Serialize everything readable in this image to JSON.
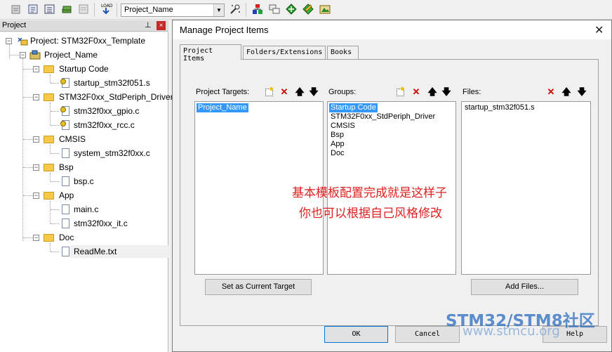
{
  "toolbar": {
    "target_select": {
      "value": "Project_Name"
    },
    "icons": [
      "translate-icon",
      "build-icon",
      "rebuild-icon",
      "batch-build-icon",
      "stop-build-icon",
      "download-icon",
      "target-options-icon",
      "manage-components-icon",
      "file-extensions-icon",
      "pack-installer-icon",
      "select-software-packs-icon",
      "manage-rte-icon"
    ]
  },
  "project_panel": {
    "title": "Project",
    "pin_glyph": "⊥",
    "close_glyph": "×",
    "tree": {
      "root": "Project: STM32F0xx_Template",
      "target": "Project_Name",
      "groups": [
        {
          "name": "Startup Code",
          "files": [
            "startup_stm32f051.s"
          ]
        },
        {
          "name": "STM32F0xx_StdPeriph_Driver",
          "files": [
            "stm32f0xx_gpio.c",
            "stm32f0xx_rcc.c"
          ]
        },
        {
          "name": "CMSIS",
          "files": [
            "system_stm32f0xx.c"
          ]
        },
        {
          "name": "Bsp",
          "files": [
            "bsp.c"
          ]
        },
        {
          "name": "App",
          "files": [
            "main.c",
            "stm32f0xx_it.c"
          ]
        },
        {
          "name": "Doc",
          "files": [
            "ReadMe.txt"
          ]
        }
      ]
    }
  },
  "dialog": {
    "title": "Manage Project Items",
    "close_glyph": "✕",
    "tabs": [
      "Project Items",
      "Folders/Extensions",
      "Books"
    ],
    "project_targets": {
      "label": "Project Targets:",
      "items": [
        "Project_Name"
      ],
      "selected": 0
    },
    "groups": {
      "label": "Groups:",
      "items": [
        "Startup Code",
        "STM32F0xx_StdPeriph_Driver",
        "CMSIS",
        "Bsp",
        "App",
        "Doc"
      ],
      "selected": 0
    },
    "files": {
      "label": "Files:",
      "items": [
        "startup_stm32f051.s"
      ]
    },
    "buttons": {
      "set_current_target": "Set as Current Target",
      "add_files": "Add Files...",
      "ok": "OK",
      "cancel": "Cancel",
      "help": "Help"
    },
    "annotation": {
      "line1": "基本模板配置完成就是这样子",
      "line2": "你也可以根据自己风格修改",
      "color": "#e02020"
    }
  },
  "watermark": {
    "main": "STM32/STM8社区",
    "sub": "www.stmcu.org"
  }
}
